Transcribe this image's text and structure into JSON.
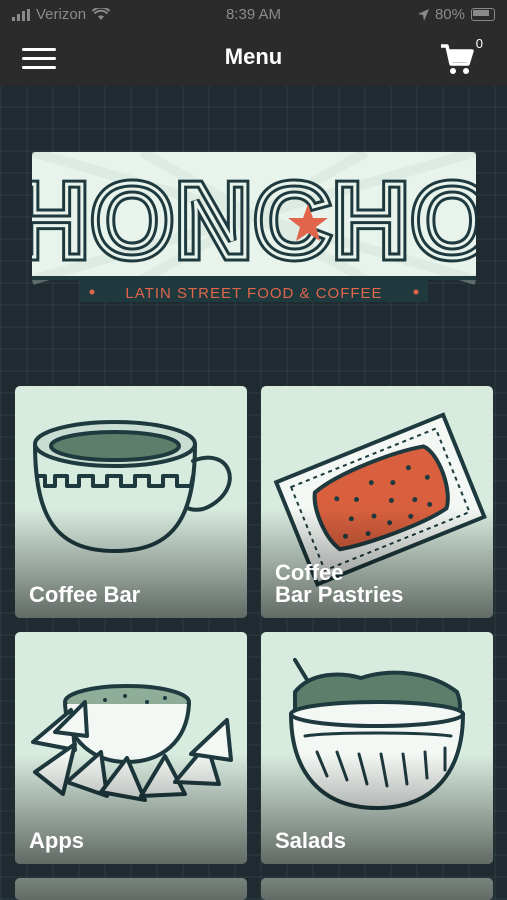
{
  "status_bar": {
    "carrier": "Verizon",
    "time": "8:39 AM",
    "battery": "80%"
  },
  "header": {
    "title": "Menu",
    "cart_count": "0"
  },
  "logo": {
    "name": "HONCHO",
    "tagline": "LATIN STREET FOOD & COFFEE"
  },
  "categories": [
    {
      "label": "Coffee Bar"
    },
    {
      "label_line1": "Coffee",
      "label_line2": "Bar Pastries"
    },
    {
      "label": "Apps"
    },
    {
      "label": "Salads"
    }
  ],
  "colors": {
    "accent": "#e0654b",
    "ink": "#1e3a3f",
    "card_bg": "#d8ebdf",
    "bar_bg": "#2b2b2b"
  }
}
